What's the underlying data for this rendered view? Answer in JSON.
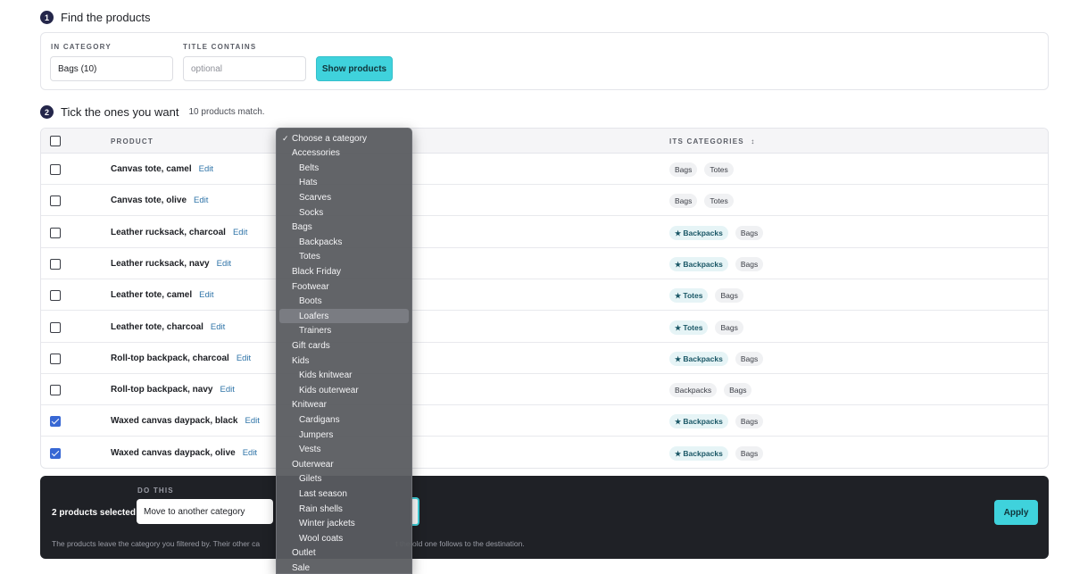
{
  "step1": {
    "num": "1",
    "title": "Find the products"
  },
  "filters": {
    "category_label": "IN CATEGORY",
    "category_value": "Bags  (10)",
    "title_label": "TITLE CONTAINS",
    "title_placeholder": "optional",
    "show_button": "Show products"
  },
  "step2": {
    "num": "2",
    "title": "Tick the ones you want",
    "sub": "10 products match."
  },
  "table": {
    "col_product": "PRODUCT",
    "col_categories": "ITS CATEGORIES",
    "sort_icon": "sort-icon",
    "edit_label": "Edit",
    "rows": [
      {
        "name": "Canvas tote, camel",
        "checked": false,
        "tags": [
          {
            "label": "Bags",
            "primary": false
          },
          {
            "label": "Totes",
            "primary": false
          }
        ]
      },
      {
        "name": "Canvas tote, olive",
        "checked": false,
        "tags": [
          {
            "label": "Bags",
            "primary": false
          },
          {
            "label": "Totes",
            "primary": false
          }
        ]
      },
      {
        "name": "Leather rucksack, charcoal",
        "checked": false,
        "tags": [
          {
            "label": "Backpacks",
            "primary": true
          },
          {
            "label": "Bags",
            "primary": false
          }
        ]
      },
      {
        "name": "Leather rucksack, navy",
        "checked": false,
        "tags": [
          {
            "label": "Backpacks",
            "primary": true
          },
          {
            "label": "Bags",
            "primary": false
          }
        ]
      },
      {
        "name": "Leather tote, camel",
        "checked": false,
        "tags": [
          {
            "label": "Totes",
            "primary": true
          },
          {
            "label": "Bags",
            "primary": false
          }
        ]
      },
      {
        "name": "Leather tote, charcoal",
        "checked": false,
        "tags": [
          {
            "label": "Totes",
            "primary": true
          },
          {
            "label": "Bags",
            "primary": false
          }
        ]
      },
      {
        "name": "Roll-top backpack, charcoal",
        "checked": false,
        "tags": [
          {
            "label": "Backpacks",
            "primary": true
          },
          {
            "label": "Bags",
            "primary": false
          }
        ]
      },
      {
        "name": "Roll-top backpack, navy",
        "checked": false,
        "tags": [
          {
            "label": "Backpacks",
            "primary": false
          },
          {
            "label": "Bags",
            "primary": false
          }
        ]
      },
      {
        "name": "Waxed canvas daypack, black",
        "checked": true,
        "tags": [
          {
            "label": "Backpacks",
            "primary": true
          },
          {
            "label": "Bags",
            "primary": false
          }
        ]
      },
      {
        "name": "Waxed canvas daypack, olive",
        "checked": true,
        "tags": [
          {
            "label": "Backpacks",
            "primary": true
          },
          {
            "label": "Bags",
            "primary": false
          }
        ]
      }
    ]
  },
  "action_bar": {
    "count": "2 products selected",
    "do_label": "DO THIS",
    "action_value": "Move to another category",
    "apply": "Apply",
    "note_a": "The products leave the category you filtered by. Their other ca",
    "note_b": "t the old one follows to the destination."
  },
  "dropdown": {
    "items": [
      {
        "label": "Choose a category",
        "level": 0,
        "selected": true
      },
      {
        "label": "Accessories",
        "level": 0
      },
      {
        "label": "Belts",
        "level": 1
      },
      {
        "label": "Hats",
        "level": 1
      },
      {
        "label": "Scarves",
        "level": 1
      },
      {
        "label": "Socks",
        "level": 1
      },
      {
        "label": "Bags",
        "level": 0
      },
      {
        "label": "Backpacks",
        "level": 1
      },
      {
        "label": "Totes",
        "level": 1
      },
      {
        "label": "Black Friday",
        "level": 0
      },
      {
        "label": "Footwear",
        "level": 0
      },
      {
        "label": "Boots",
        "level": 1
      },
      {
        "label": "Loafers",
        "level": 1,
        "hover": true
      },
      {
        "label": "Trainers",
        "level": 1
      },
      {
        "label": "Gift cards",
        "level": 0
      },
      {
        "label": "Kids",
        "level": 0
      },
      {
        "label": "Kids knitwear",
        "level": 1
      },
      {
        "label": "Kids outerwear",
        "level": 1
      },
      {
        "label": "Knitwear",
        "level": 0
      },
      {
        "label": "Cardigans",
        "level": 1
      },
      {
        "label": "Jumpers",
        "level": 1
      },
      {
        "label": "Vests",
        "level": 1
      },
      {
        "label": "Outerwear",
        "level": 0
      },
      {
        "label": "Gilets",
        "level": 1
      },
      {
        "label": "Last season",
        "level": 1
      },
      {
        "label": "Rain shells",
        "level": 1
      },
      {
        "label": "Winter jackets",
        "level": 1
      },
      {
        "label": "Wool coats",
        "level": 1
      },
      {
        "label": "Outlet",
        "level": 0
      },
      {
        "label": "Sale",
        "level": 0
      }
    ]
  },
  "colors": {
    "accent": "#3fd2dc",
    "checkbox": "#3868d4",
    "dark_bar": "#1f2126"
  }
}
